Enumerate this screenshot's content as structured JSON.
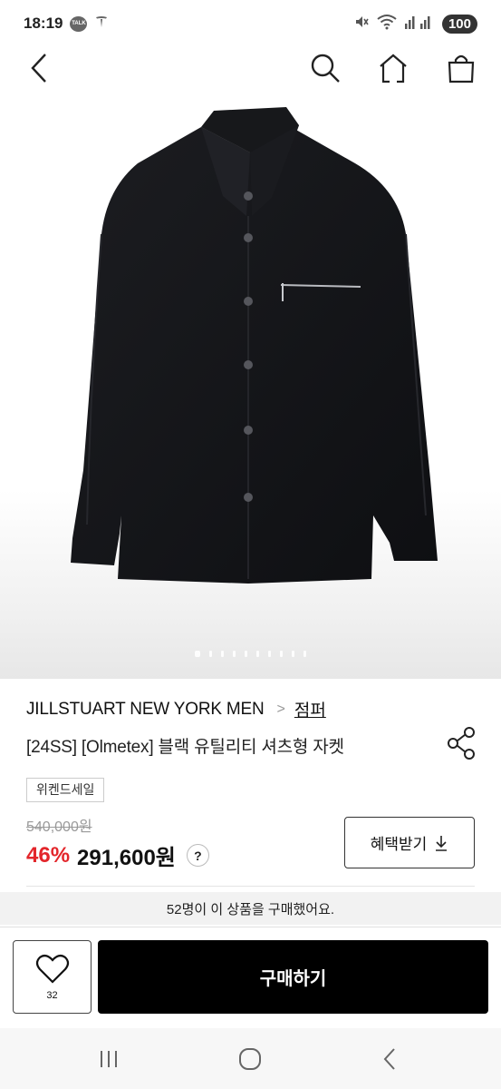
{
  "status_bar": {
    "time": "18:19",
    "talk_badge": "TALK",
    "battery": "100"
  },
  "app_bar": {
    "back_icon": "chevron-left-icon",
    "search_icon": "search-icon",
    "home_icon": "home-icon",
    "bag_icon": "shopping-bag-icon"
  },
  "gallery": {
    "image_alt": "black shirt jacket",
    "page_count": 10,
    "current_page": 1
  },
  "product": {
    "brand": "JILLSTUART NEW YORK MEN",
    "breadcrumb_sep": ">",
    "category": "점퍼",
    "title": "[24SS] [Olmetex] 블랙 유틸리티 셔츠형 자켓",
    "tag": "위켄드세일",
    "original_price": "540,000원",
    "discount": "46%",
    "sale_price": "291,600원",
    "help": "?",
    "benefit_button": "혜택받기",
    "purchase_notice": "52명이 이 상품을 구매했어요."
  },
  "bottom_bar": {
    "like_count": "32",
    "buy_button": "구매하기"
  },
  "colors": {
    "accent_discount": "#e3262b",
    "buy_button_bg": "#000000"
  }
}
